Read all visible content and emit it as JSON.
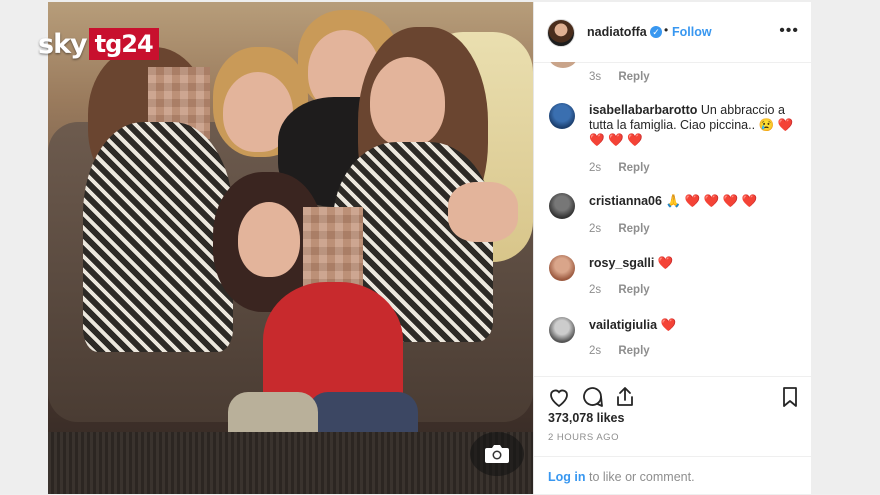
{
  "brand": {
    "sky": "sky",
    "tg24": "tg24"
  },
  "post": {
    "author": "nadiatoffa",
    "verified_mark": "✓",
    "separator": "•",
    "follow_label": "Follow",
    "more_label": "•••",
    "likes": "373,078 likes",
    "time": "2 HOURS AGO",
    "login_link": "Log in",
    "login_suffix": " to like or comment."
  },
  "comments": [
    {
      "user": "",
      "text": "",
      "age": "3s",
      "reply": "Reply"
    },
    {
      "user": "isabellabarbarotto",
      "text": " Un abbraccio a tutta la famiglia. Ciao piccina.. 😢 ❤️ ❤️ ❤️ ❤️",
      "age": "2s",
      "reply": "Reply"
    },
    {
      "user": "cristianna06",
      "text": " 🙏 ❤️ ❤️ ❤️ ❤️",
      "age": "2s",
      "reply": "Reply"
    },
    {
      "user": "rosy_sgalli",
      "text": " ❤️",
      "age": "2s",
      "reply": "Reply"
    },
    {
      "user": "vailatigiulia",
      "text": " ❤️",
      "age": "2s",
      "reply": "Reply"
    }
  ],
  "icons": [
    "heart-icon",
    "comment-icon",
    "share-icon",
    "bookmark-icon",
    "camera-icon",
    "more-icon"
  ],
  "colors": {
    "accent": "#3897f0",
    "brand_red": "#c8102e",
    "heart": "#d0021b"
  }
}
